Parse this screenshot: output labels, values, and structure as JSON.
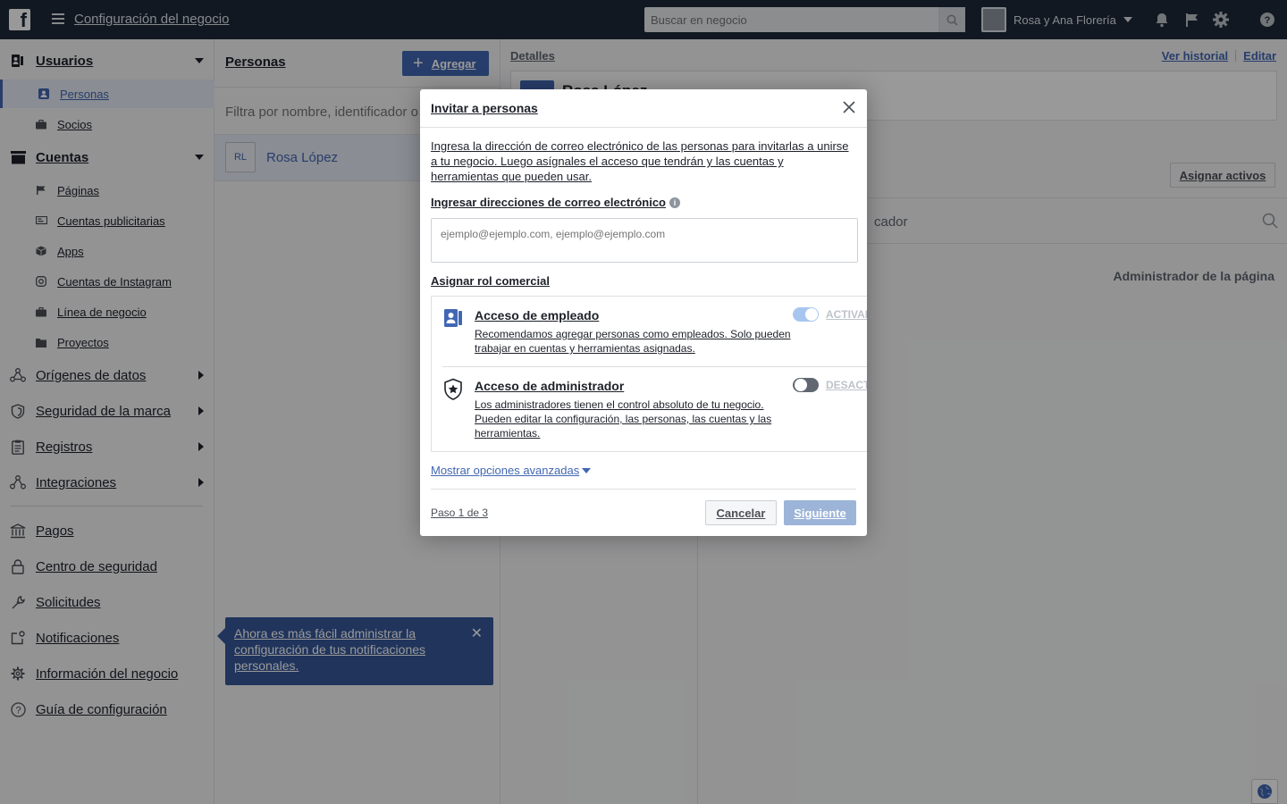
{
  "topbar": {
    "logo": "f",
    "app_title": "Configuración del negocio",
    "search_placeholder": "Buscar en negocio",
    "business_name": "Rosa y Ana Florería",
    "icons": [
      "bell-icon",
      "flag-icon",
      "gear-icon",
      "help-icon"
    ]
  },
  "sidebar": {
    "sections": [
      {
        "label": "Usuarios",
        "icon": "users-icon",
        "expanded": true,
        "items": [
          {
            "label": "Personas",
            "icon": "person-icon",
            "active": true
          },
          {
            "label": "Socios",
            "icon": "briefcase-icon"
          }
        ]
      },
      {
        "label": "Cuentas",
        "icon": "folder-icon",
        "expanded": true,
        "items": [
          {
            "label": "Páginas",
            "icon": "flag-icon"
          },
          {
            "label": "Cuentas publicitarias",
            "icon": "ad-account-icon"
          },
          {
            "label": "Apps",
            "icon": "cube-icon"
          },
          {
            "label": "Cuentas de Instagram",
            "icon": "instagram-icon"
          },
          {
            "label": "Línea de negocio",
            "icon": "briefcase-icon"
          },
          {
            "label": "Proyectos",
            "icon": "folder-icon"
          }
        ]
      },
      {
        "label": "Orígenes de datos",
        "icon": "data-sources-icon"
      },
      {
        "label": "Seguridad de la marca",
        "icon": "shield-icon"
      },
      {
        "label": "Registros",
        "icon": "clipboard-icon"
      },
      {
        "label": "Integraciones",
        "icon": "integrations-icon"
      }
    ],
    "bottom": [
      {
        "label": "Pagos",
        "icon": "bank-icon"
      },
      {
        "label": "Centro de seguridad",
        "icon": "lock-icon"
      },
      {
        "label": "Solicitudes",
        "icon": "wrench-icon"
      },
      {
        "label": "Notificaciones",
        "icon": "notification-icon"
      },
      {
        "label": "Información del negocio",
        "icon": "gear-icon"
      },
      {
        "label": "Guía de configuración",
        "icon": "question-icon"
      }
    ]
  },
  "people": {
    "title": "Personas",
    "add_label": "Agregar",
    "filter_placeholder": "Filtra por nombre, identificador o correo",
    "list": [
      {
        "initials": "RL",
        "name": "Rosa López"
      }
    ],
    "tip": "Ahora es más fácil administrar la configuración de tus notificaciones personales."
  },
  "details": {
    "header": "Detalles",
    "history_link": "Ver historial",
    "edit_link": "Editar",
    "person_name": "Rosa López",
    "assign_button": "Asignar activos",
    "search_placeholder_fragment": "cador",
    "role_text": "Administrador de la página"
  },
  "modal": {
    "title": "Invitar a personas",
    "description": "Ingresa la dirección de correo electrónico de las personas para invitarlas a unirse a tu negocio. Luego asígnales el acceso que tendrán y las cuentas y herramientas que pueden usar.",
    "email_label": "Ingresar direcciones de correo electrónico",
    "email_placeholder": "ejemplo@ejemplo.com, ejemplo@ejemplo.com",
    "role_label": "Asignar rol comercial",
    "roles": [
      {
        "title": "Acceso de empleado",
        "description": "Recomendamos agregar personas como empleados. Solo pueden trabajar en cuentas y herramientas asignadas.",
        "state_label": "ACTIVAD",
        "on": true
      },
      {
        "title": "Acceso de administrador",
        "description": "Los administradores tienen el control absoluto de tu negocio. Pueden editar la configuración, las personas, las cuentas y las herramientas.",
        "state_label": "DESACT",
        "on": false
      }
    ],
    "advanced_link": "Mostrar opciones avanzadas",
    "step": "Paso 1 de 3",
    "cancel_label": "Cancelar",
    "next_label": "Siguiente"
  }
}
